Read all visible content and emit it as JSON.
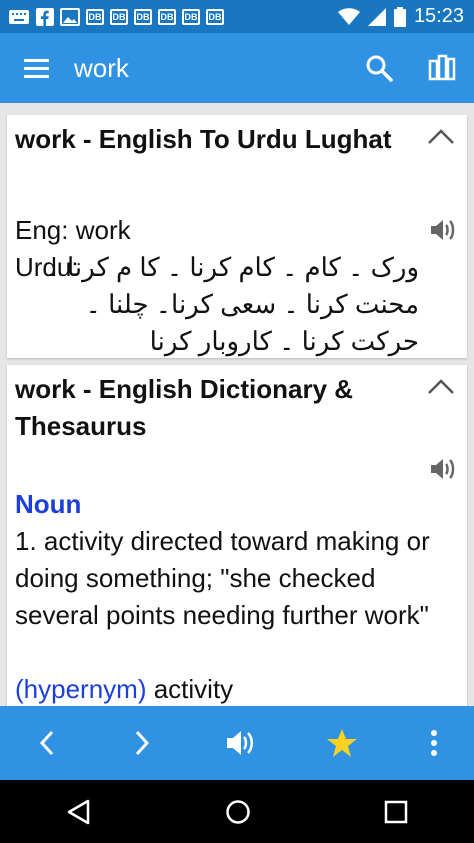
{
  "status_bar": {
    "time": "15:23",
    "notification_icons": [
      "keyboard-icon",
      "facebook-icon",
      "image-icon",
      "DB",
      "DB",
      "DB",
      "DB",
      "DB",
      "DB"
    ]
  },
  "app_bar": {
    "search_query": "work"
  },
  "cards": [
    {
      "title": "work - English To Urdu Lughat",
      "eng_line": "Eng: work",
      "urdu_label": "Urdu:",
      "urdu_text": "ورک ۔ کام ۔ کام کرنا ۔ کا م کرنا ۔ محنت کرنا ۔ سعی کرنا۔ چلنا ۔ حرکت کرنا ۔ کاروبار کرنا"
    },
    {
      "title": "work - English Dictionary & Thesaurus",
      "part_of_speech": "Noun",
      "definition": "1. activity directed toward making or doing something; \"she checked several points needing further work\"",
      "relation_label": "(hypernym)",
      "relation_value": "activity"
    }
  ],
  "colors": {
    "primary": "#2f92e2",
    "status_bar": "#1877c0",
    "link": "#1b3fd8",
    "star": "#ffd21f"
  }
}
